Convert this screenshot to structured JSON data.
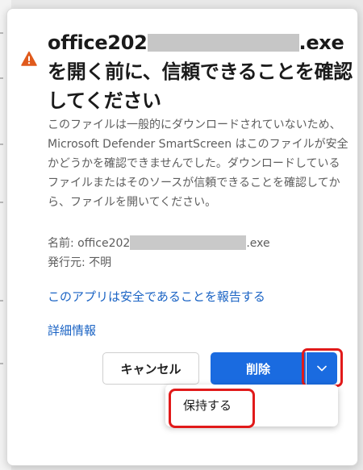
{
  "dialog": {
    "title_prefix": "office202",
    "title_suffix": ".exeを開く前に、信頼できることを確認してください",
    "body": "このファイルは一般的にダウンロードされていないため、Microsoft Defender SmartScreen はこのファイルが安全かどうかを確認できませんでした。ダウンロードしているファイルまたはそのソースが信頼できることを確認してから、ファイルを開いてください。",
    "name_label": "名前: office202",
    "name_suffix": ".exe",
    "publisher": "発行元: 不明",
    "report_link": "このアプリは安全であることを報告する",
    "details_link": "詳細情報",
    "cancel_label": "キャンセル",
    "delete_label": "削除",
    "dropdown_icon": "chevron-down-icon",
    "menu_keep": "保持する",
    "warning_icon": "warning-icon"
  },
  "colors": {
    "warning": "#e05a1c",
    "primary": "#1a6be0",
    "link": "#1a63c4",
    "highlight": "#e11a1a"
  }
}
